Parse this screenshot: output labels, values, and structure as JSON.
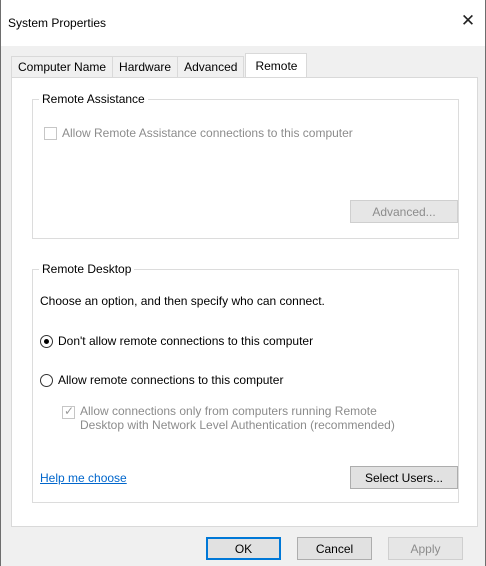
{
  "window": {
    "title": "System Properties"
  },
  "tabs": [
    {
      "label": "Computer Name"
    },
    {
      "label": "Hardware"
    },
    {
      "label": "Advanced"
    },
    {
      "label": "Remote"
    }
  ],
  "remote_assistance": {
    "group_title": "Remote Assistance",
    "allow_checkbox_label": "Allow Remote Assistance connections to this computer",
    "allow_checked": false,
    "advanced_button": "Advanced..."
  },
  "remote_desktop": {
    "group_title": "Remote Desktop",
    "instruction": "Choose an option, and then specify who can connect.",
    "option_dont_allow": "Don't allow remote connections to this computer",
    "option_allow": "Allow remote connections to this computer",
    "selected_option": "dont_allow",
    "nla_line1": "Allow connections only from computers running Remote",
    "nla_line2": "Desktop with Network Level Authentication (recommended)",
    "nla_checked": true,
    "help_link": "Help me choose",
    "select_users_button": "Select Users..."
  },
  "footer": {
    "ok": "OK",
    "cancel": "Cancel",
    "apply": "Apply"
  },
  "icons": {
    "close": "close-icon"
  }
}
